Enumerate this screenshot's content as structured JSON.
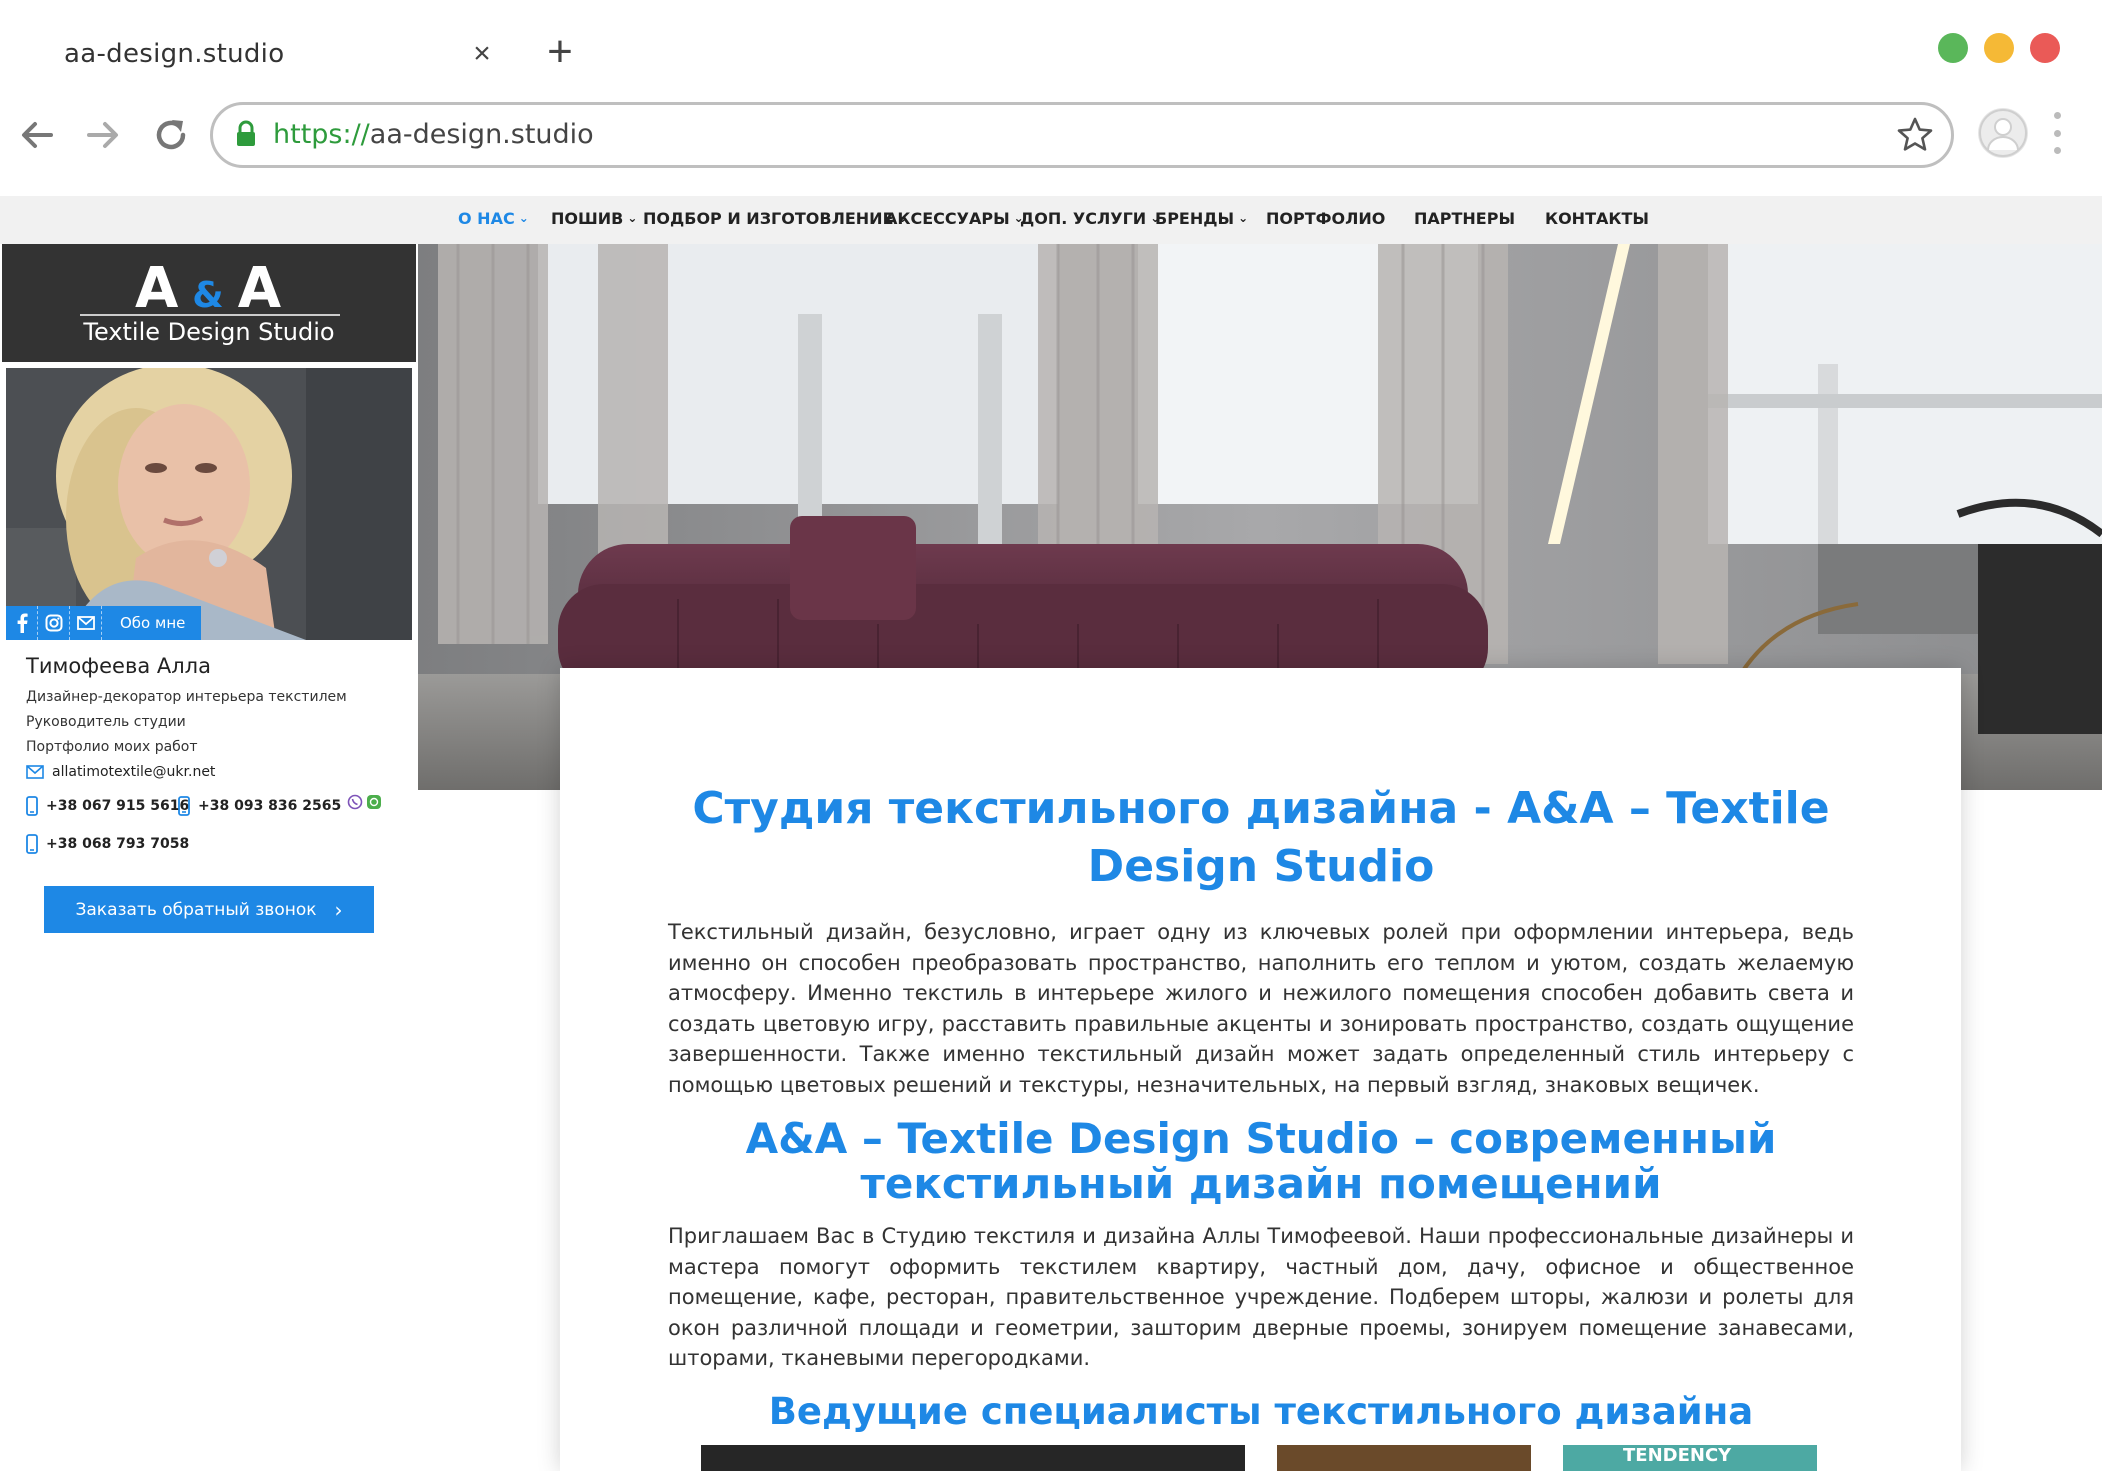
{
  "browser": {
    "tab_title": "aa-design.studio",
    "tab_close": "×",
    "new_tab": "+",
    "url_scheme": "https://",
    "url_host": "aa-design.studio"
  },
  "nav": {
    "items": [
      {
        "label": "О НАС",
        "dropdown": true,
        "active": true
      },
      {
        "label": "ПОШИВ",
        "dropdown": true
      },
      {
        "label": "ПОДБОР И ИЗГОТОВЛЕНИЕ",
        "dropdown": true
      },
      {
        "label": "АКСЕССУАРЫ",
        "dropdown": true
      },
      {
        "label": "ДОП. УСЛУГИ",
        "dropdown": true
      },
      {
        "label": "БРЕНДЫ",
        "dropdown": true
      },
      {
        "label": "ПОРТФОЛИО",
        "dropdown": false
      },
      {
        "label": "ПАРТНЕРЫ",
        "dropdown": false
      },
      {
        "label": "КОНТАКТЫ",
        "dropdown": false
      }
    ]
  },
  "sidebar": {
    "brand_letter_a1": "A",
    "brand_amp": "&",
    "brand_letter_a2": "A",
    "brand_subtitle": "Textile Design Studio",
    "about_label": "Обо мне",
    "name": "Тимофеева Алла",
    "line1": "Дизайнер-декоратор интерьера текстилем",
    "line2": "Руководитель студии",
    "line3": "Портфолио моих работ",
    "email": "allatimotextile@ukr.net",
    "phone1": "+38 067 915 5616",
    "phone2": "+38 093 836 2565",
    "phone3": "+38 068 793 7058",
    "callback_label": "Заказать обратный звонок",
    "callback_chevron": "›"
  },
  "main": {
    "heading1": "Студия текстильного дизайна - A&A – Textile Design Studio",
    "paragraph1": "Текстильный дизайн, безусловно, играет одну из ключевых ролей при оформлении интерьера, ведь именно он способен преобразовать пространство, наполнить его теплом и уютом, создать желаемую атмосферу. Именно текстиль в интерьере жилого и нежилого помещения способен добавить света и создать цветовую игру, расставить правильные акценты и зонировать пространство, создать ощущение завершенности. Также именно текстильный дизайн может задать определенный стиль интерьеру с помощью цветовых решений и текстуры, незначительных, на первый взгляд, знаковых вещичек.",
    "heading2": "A&A – Textile Design Studio – современный текстильный дизайн помещений",
    "paragraph2": "Приглашаем Вас в Студию текстиля и дизайна Аллы Тимофеевой. Наши профессиональные дизайнеры и мастера помогут оформить текстилем квартиру, частный дом, дачу, офисное и общественное помещение, кафе, ресторан, правительственное учреждение. Подберем шторы, жалюзи и ролеты для окон различной площади и геометрии, зашторим дверные проемы, зонируем помещение занавесами, шторами, тканевыми перегородками.",
    "heading3": "Ведущие специалисты текстильного дизайна",
    "thumb3_text": "TENDENCY"
  },
  "colors": {
    "accent": "#1e88e5",
    "url_secure": "#2e9b3c",
    "brand_box": "#333333"
  }
}
